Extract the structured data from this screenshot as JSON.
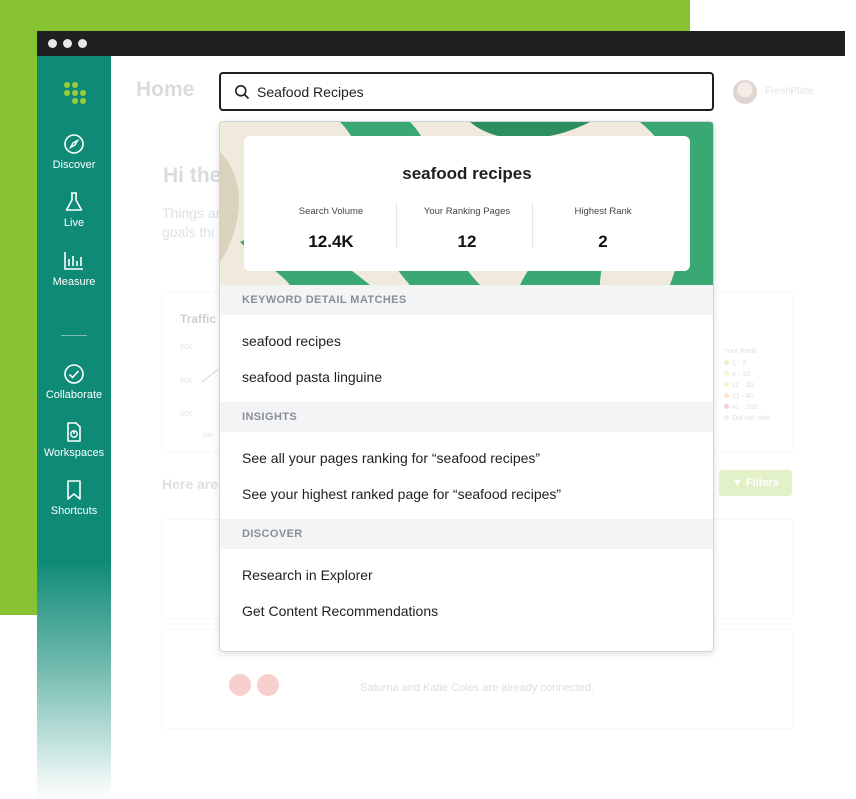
{
  "app": {
    "page_title": "Home",
    "account_name": "FreshPlate"
  },
  "sidebar": {
    "items": [
      {
        "label": "Discover",
        "icon": "compass-icon"
      },
      {
        "label": "Live",
        "icon": "flask-icon"
      },
      {
        "label": "Measure",
        "icon": "bar-chart-icon"
      },
      {
        "label": "Collaborate",
        "icon": "check-circle-icon"
      },
      {
        "label": "Workspaces",
        "icon": "document-chart-icon"
      },
      {
        "label": "Shortcuts",
        "icon": "bookmark-icon"
      }
    ]
  },
  "background": {
    "greeting": "Hi the",
    "subtitle_line1": "Things ar",
    "subtitle_line2": "goals thi",
    "traffic_label": "Traffic",
    "y_ticks": [
      "50K",
      "40K",
      "30K"
    ],
    "x_tick": "Jan",
    "legend_title": "Your Rank",
    "legend": [
      "1 - 3",
      "4 - 10",
      "11 - 20",
      "21 - 40",
      "41 - 100",
      "Did not rank"
    ],
    "here_are": "Here are",
    "filters_label": "Filters",
    "connected_text": "Saturna and Katie Coles are already connected."
  },
  "search": {
    "value": "Seafood Recipes"
  },
  "keyword_card": {
    "title": "seafood recipes",
    "stats": [
      {
        "label": "Search Volume",
        "value": "12.4K"
      },
      {
        "label": "Your Ranking Pages",
        "value": "12"
      },
      {
        "label": "Highest Rank",
        "value": "2"
      }
    ]
  },
  "sections": {
    "keyword_matches": {
      "header": "KEYWORD DETAIL MATCHES",
      "items": [
        "seafood recipes",
        "seafood pasta linguine"
      ]
    },
    "insights": {
      "header": "INSIGHTS",
      "items": [
        "See all your pages ranking for “seafood recipes”",
        "See your highest ranked page for “seafood recipes”"
      ]
    },
    "discover": {
      "header": "DISCOVER",
      "items": [
        "Research in Explorer",
        "Get Content Recommendations"
      ]
    }
  },
  "colors": {
    "brand_teal": "#0f8a77",
    "brand_green": "#86c232",
    "accent_green": "#9ccb3b",
    "leaf_green": "#3aa872"
  }
}
